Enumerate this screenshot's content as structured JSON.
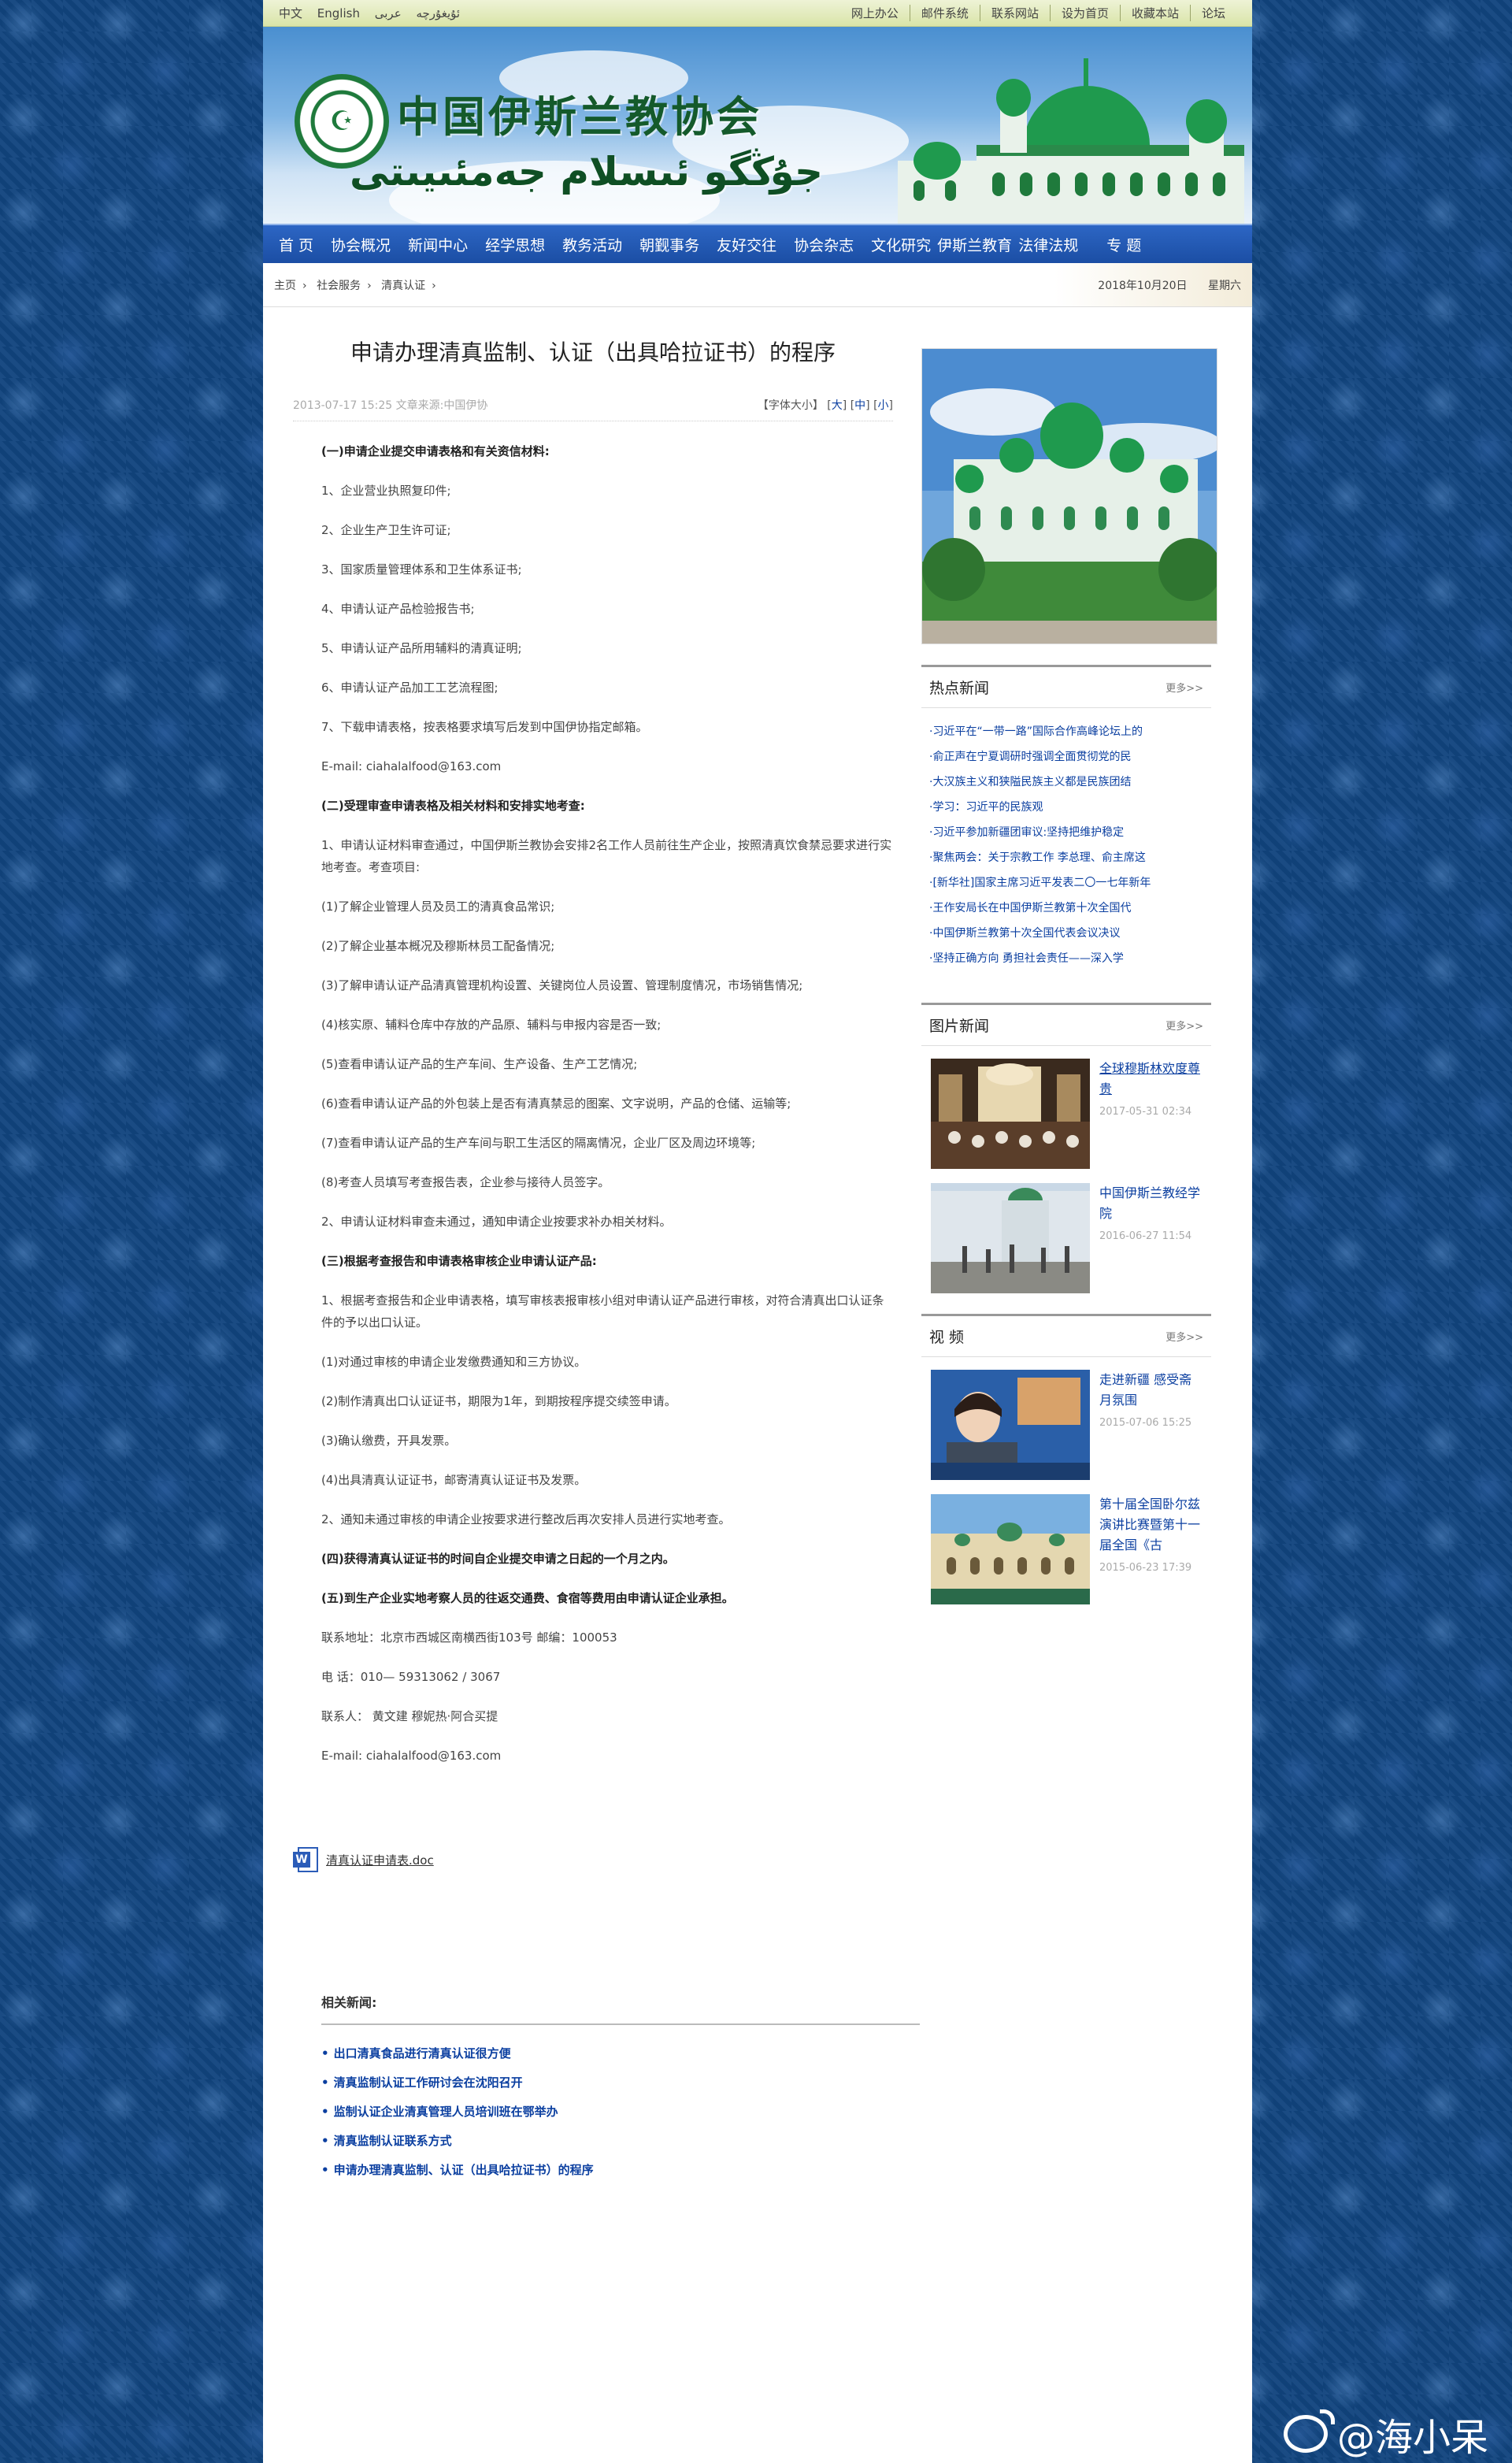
{
  "topbar": {
    "lang_cn": "中文",
    "lang_en": "English",
    "lang_ar": "عربى",
    "lang_ug": "ئۇيغۇرچە",
    "links": [
      "网上办公",
      "邮件系统",
      "联系网站",
      "设为首页",
      "收藏本站",
      "论坛"
    ]
  },
  "banner": {
    "title_cn": "中国伊斯兰教协会",
    "title_ug": "جۇڭگو ئىسلام جەمئىيىتى"
  },
  "nav": [
    "首 页",
    "协会概况",
    "新闻中心",
    "经学思想",
    "教务活动",
    "朝觐事务",
    "友好交往",
    "协会杂志",
    "文化研究",
    "伊斯兰教育",
    "法律法规",
    "专 题"
  ],
  "breadcrumb": {
    "items": [
      "主页",
      "社会服务",
      "清真认证"
    ],
    "date": "2018年10月20日",
    "weekday": "星期六"
  },
  "article": {
    "title": "申请办理清真监制、认证（出具哈拉证书）的程序",
    "meta": "2013-07-17 15:25 文章来源:中国伊协",
    "font_size_label": "【字体大小】",
    "font_large": "大",
    "font_medium": "中",
    "font_small": "小",
    "paragraphs": [
      {
        "bold": true,
        "text": "(一)申请企业提交申请表格和有关资信材料:"
      },
      {
        "bold": false,
        "text": "1、企业营业执照复印件;"
      },
      {
        "bold": false,
        "text": "2、企业生产卫生许可证;"
      },
      {
        "bold": false,
        "text": "3、国家质量管理体系和卫生体系证书;"
      },
      {
        "bold": false,
        "text": "4、申请认证产品检验报告书;"
      },
      {
        "bold": false,
        "text": "5、申请认证产品所用辅料的清真证明;"
      },
      {
        "bold": false,
        "text": "6、申请认证产品加工工艺流程图;"
      },
      {
        "bold": false,
        "text": "7、下载申请表格，按表格要求填写后发到中国伊协指定邮箱。"
      },
      {
        "bold": false,
        "text": "E-mail: ciahalalfood@163.com"
      },
      {
        "bold": true,
        "text": "(二)受理审查申请表格及相关材料和安排实地考查:"
      },
      {
        "bold": false,
        "text": "1、申请认证材料审查通过，中国伊斯兰教协会安排2名工作人员前往生产企业，按照清真饮食禁忌要求进行实地考查。考查项目:"
      },
      {
        "bold": false,
        "text": "(1)了解企业管理人员及员工的清真食品常识;"
      },
      {
        "bold": false,
        "text": "(2)了解企业基本概况及穆斯林员工配备情况;"
      },
      {
        "bold": false,
        "text": "(3)了解申请认证产品清真管理机构设置、关键岗位人员设置、管理制度情况，市场销售情况;"
      },
      {
        "bold": false,
        "text": "(4)核实原、辅料仓库中存放的产品原、辅料与申报内容是否一致;"
      },
      {
        "bold": false,
        "text": "(5)查看申请认证产品的生产车间、生产设备、生产工艺情况;"
      },
      {
        "bold": false,
        "text": "(6)查看申请认证产品的外包装上是否有清真禁忌的图案、文字说明，产品的仓储、运输等;"
      },
      {
        "bold": false,
        "text": "(7)查看申请认证产品的生产车间与职工生活区的隔离情况，企业厂区及周边环境等;"
      },
      {
        "bold": false,
        "text": "(8)考查人员填写考查报告表，企业参与接待人员签字。"
      },
      {
        "bold": false,
        "text": "2、申请认证材料审查未通过，通知申请企业按要求补办相关材料。"
      },
      {
        "bold": true,
        "text": "(三)根据考查报告和申请表格审核企业申请认证产品:"
      },
      {
        "bold": false,
        "text": "1、根据考查报告和企业申请表格，填写审核表报审核小组对申请认证产品进行审核，对符合清真出口认证条件的予以出口认证。"
      },
      {
        "bold": false,
        "text": "(1)对通过审核的申请企业发缴费通知和三方协议。"
      },
      {
        "bold": false,
        "text": "(2)制作清真出口认证证书，期限为1年，到期按程序提交续签申请。"
      },
      {
        "bold": false,
        "text": "(3)确认缴费，开具发票。"
      },
      {
        "bold": false,
        "text": "(4)出具清真认证证书，邮寄清真认证证书及发票。"
      },
      {
        "bold": false,
        "text": "2、通知未通过审核的申请企业按要求进行整改后再次安排人员进行实地考查。"
      },
      {
        "bold": true,
        "text": "(四)获得清真认证证书的时间自企业提交申请之日起的一个月之内。"
      },
      {
        "bold": true,
        "text": "(五)到生产企业实地考察人员的往返交通费、食宿等费用由申请认证企业承担。"
      },
      {
        "bold": false,
        "text": "联系地址：北京市西城区南横西街103号 邮编：100053"
      },
      {
        "bold": false,
        "text": "电 话：010— 59313062    / 3067"
      },
      {
        "bold": false,
        "text": "联系人：  黄文建         穆妮热·阿合买提"
      },
      {
        "bold": false,
        "text": "E-mail: ciahalalfood@163.com"
      }
    ],
    "attachment": "清真认证申请表.doc",
    "related_title": "相关新闻:",
    "related": [
      "出口清真食品进行清真认证很方便",
      "清真监制认证工作研讨会在沈阳召开",
      "监制认证企业清真管理人员培训班在鄂举办",
      "清真监制认证联系方式",
      "申请办理清真监制、认证（出具哈拉证书）的程序"
    ]
  },
  "sidebar": {
    "hot_title": "热点新闻",
    "more": "更多>>",
    "hot": [
      "·习近平在“一带一路”国际合作高峰论坛上的",
      "·俞正声在宁夏调研时强调全面贯彻党的民",
      "·大汉族主义和狭隘民族主义都是民族团结",
      "·学习：习近平的民族观",
      "·习近平参加新疆团审议:坚持把维护稳定",
      "·聚焦两会：关于宗教工作 李总理、俞主席这",
      "·[新华社]国家主席习近平发表二〇一七年新年",
      "·王作安局长在中国伊斯兰教第十次全国代",
      "·中国伊斯兰教第十次全国代表会议决议",
      "·坚持正确方向 勇担社会责任——深入学"
    ],
    "pic_title": "图片新闻",
    "pics": [
      {
        "caption": "全球穆斯林欢度尊贵",
        "time": "2017-05-31 02:34"
      },
      {
        "caption": "中国伊斯兰教经学院",
        "time": "2016-06-27 11:54"
      }
    ],
    "video_title": "视 频",
    "videos": [
      {
        "caption": "走进新疆 感受斋月氛围",
        "time": "2015-07-06 15:25"
      },
      {
        "caption": "第十届全国卧尔兹演讲比赛暨第十一届全国《古",
        "time": "2015-06-23 17:39"
      }
    ]
  },
  "watermark": "@海小呆",
  "colors": {
    "nav": "#1f54ab",
    "link": "#0b3fa0",
    "bg": "#11447e"
  }
}
